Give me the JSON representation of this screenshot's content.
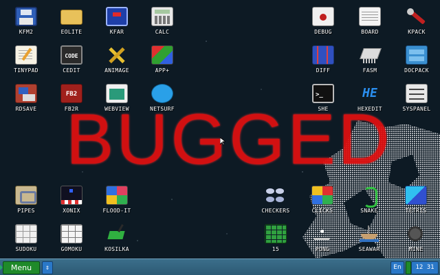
{
  "overlay_text": "BUGGED",
  "desktop_icons": {
    "kfm2": "KFM2",
    "eolite": "EOLITE",
    "kfar": "KFAR",
    "calc": "CALC",
    "debug": "DEBUG",
    "board": "BOARD",
    "kpack": "KPACK",
    "tinypad": "TINYPAD",
    "cedit": "CEDIT",
    "animage": "ANIMAGE",
    "app_plus": "APP+",
    "diff": "DIFF",
    "fasm": "FASM",
    "docpack": "DOCPACK",
    "rdsave": "RDSAVE",
    "fb2read": "FB2R",
    "webview": "WEBVIEW",
    "netsurf": "NETSURF",
    "shell": "SHE",
    "hexedit": "HEXEDIT",
    "syspanel": "SYSPANEL",
    "pipes": "PIPES",
    "xonix": "XONIX",
    "flood_it": "FLOOD-IT",
    "checkers": "CHECKERS",
    "clicks": "CLICKS",
    "snake": "SNAKE",
    "tetris": "TETRIS",
    "sudoku": "SUDOKU",
    "gomoku": "GOMOKU",
    "kosilka": "KOSILKA",
    "game15": "15",
    "pong": "PONG",
    "seawar": "SEAWAR",
    "mine": "MINE"
  },
  "icon_glyph_text": {
    "cedit": "CODE",
    "fb2": "FB2",
    "hexedit": "HE",
    "shell": ">_"
  },
  "taskbar": {
    "menu_label": "Menu",
    "up_arrow": "⇕",
    "language": "En",
    "clock": "12 31"
  },
  "colors": {
    "desktop_bg": "#0d1a24",
    "taskbar": "#2c5a74",
    "menu_button": "#1f8a2a",
    "tray_blue": "#2a78c8",
    "overlay_red": "#e01010"
  }
}
